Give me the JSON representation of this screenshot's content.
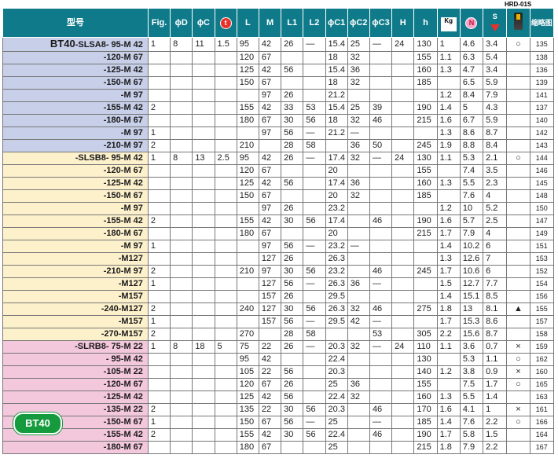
{
  "hrd_caption": "HRD-01S",
  "badge_text": "BT40",
  "headers": [
    "型号",
    "Fig.",
    "ϕD",
    "ϕC",
    "t",
    "L",
    "M",
    "L1",
    "L2",
    "ϕC1",
    "ϕC2",
    "ϕC3",
    "H",
    "h",
    "Kg",
    "N",
    "S",
    "",
    "缩略图"
  ],
  "rows": [
    {
      "g": "g1",
      "pre": "BT40",
      "base": "-SLSA8- 95-M 42",
      "v": [
        "1",
        "8",
        "11",
        "1.5",
        "95",
        "42",
        "26",
        "—",
        "15.4",
        "25",
        "—",
        "24",
        "130",
        "1",
        "4.6",
        "3.4",
        "○",
        "135"
      ]
    },
    {
      "g": "g1",
      "pre": "",
      "base": "-120-M 67",
      "v": [
        "",
        "",
        "",
        "",
        "120",
        "67",
        "",
        "",
        "18",
        "32",
        "",
        "",
        "155",
        "1.1",
        "6.3",
        "5.4",
        "",
        "138"
      ]
    },
    {
      "g": "g1",
      "pre": "",
      "base": "-125-M 42",
      "v": [
        "",
        "",
        "",
        "",
        "125",
        "42",
        "56",
        "",
        "15.4",
        "36",
        "",
        "",
        "160",
        "1.3",
        "4.7",
        "3.4",
        "",
        "136"
      ]
    },
    {
      "g": "g1",
      "pre": "",
      "base": "-150-M 67",
      "v": [
        "",
        "",
        "",
        "",
        "150",
        "67",
        "",
        "",
        "18",
        "32",
        "",
        "",
        "185",
        "",
        "6.5",
        "5.9",
        "",
        "139"
      ]
    },
    {
      "g": "g1",
      "pre": "",
      "base": "-M 97",
      "v": [
        "",
        "",
        "",
        "",
        "",
        "97",
        "26",
        "",
        "21.2",
        "",
        "",
        "",
        "",
        "1.2",
        "8.4",
        "7.9",
        "",
        "141"
      ]
    },
    {
      "g": "g1",
      "pre": "",
      "base": "-155-M 42",
      "v": [
        "2",
        "",
        "",
        "",
        "155",
        "42",
        "33",
        "53",
        "15.4",
        "25",
        "39",
        "",
        "190",
        "1.4",
        "5",
        "4.3",
        "",
        "137"
      ]
    },
    {
      "g": "g1",
      "pre": "",
      "base": "-180-M 67",
      "v": [
        "",
        "",
        "",
        "",
        "180",
        "67",
        "30",
        "56",
        "18",
        "32",
        "46",
        "",
        "215",
        "1.6",
        "6.7",
        "5.9",
        "",
        "140"
      ]
    },
    {
      "g": "g1",
      "pre": "",
      "base": "-M 97",
      "v": [
        "1",
        "",
        "",
        "",
        "",
        "97",
        "56",
        "—",
        "21.2",
        "—",
        "",
        "",
        "",
        "1.3",
        "8.6",
        "8.7",
        "",
        "142"
      ]
    },
    {
      "g": "g1",
      "pre": "",
      "base": "-210-M 97",
      "v": [
        "2",
        "",
        "",
        "",
        "210",
        "",
        "28",
        "58",
        "",
        "36",
        "50",
        "",
        "245",
        "1.9",
        "8.8",
        "8.4",
        "",
        "143"
      ]
    },
    {
      "g": "g2",
      "pre": "",
      "base": "-SLSB8- 95-M 42",
      "v": [
        "1",
        "8",
        "13",
        "2.5",
        "95",
        "42",
        "26",
        "—",
        "17.4",
        "32",
        "—",
        "24",
        "130",
        "1.1",
        "5.3",
        "2.1",
        "○",
        "144"
      ]
    },
    {
      "g": "g2",
      "pre": "",
      "base": "-120-M 67",
      "v": [
        "",
        "",
        "",
        "",
        "120",
        "67",
        "",
        "",
        "20",
        "",
        "",
        "",
        "155",
        "",
        "7.4",
        "3.5",
        "",
        "146"
      ]
    },
    {
      "g": "g2",
      "pre": "",
      "base": "-125-M 42",
      "v": [
        "",
        "",
        "",
        "",
        "125",
        "42",
        "56",
        "",
        "17.4",
        "36",
        "",
        "",
        "160",
        "1.3",
        "5.5",
        "2.3",
        "",
        "145"
      ]
    },
    {
      "g": "g2",
      "pre": "",
      "base": "-150-M 67",
      "v": [
        "",
        "",
        "",
        "",
        "150",
        "67",
        "",
        "",
        "20",
        "32",
        "",
        "",
        "185",
        "",
        "7.6",
        "4",
        "",
        "148"
      ]
    },
    {
      "g": "g2",
      "pre": "",
      "base": "-M 97",
      "v": [
        "",
        "",
        "",
        "",
        "",
        "97",
        "26",
        "",
        "23.2",
        "",
        "",
        "",
        "",
        "1.2",
        "10",
        "5.2",
        "",
        "150"
      ]
    },
    {
      "g": "g2",
      "pre": "",
      "base": "-155-M 42",
      "v": [
        "2",
        "",
        "",
        "",
        "155",
        "42",
        "30",
        "56",
        "17.4",
        "",
        "46",
        "",
        "190",
        "1.6",
        "5.7",
        "2.5",
        "",
        "147"
      ]
    },
    {
      "g": "g2",
      "pre": "",
      "base": "-180-M 67",
      "v": [
        "",
        "",
        "",
        "",
        "180",
        "67",
        "",
        "",
        "20",
        "",
        "",
        "",
        "215",
        "1.7",
        "7.9",
        "4",
        "",
        "149"
      ]
    },
    {
      "g": "g2",
      "pre": "",
      "base": "-M 97",
      "v": [
        "1",
        "",
        "",
        "",
        "",
        "97",
        "56",
        "—",
        "23.2",
        "—",
        "",
        "",
        "",
        "1.4",
        "10.2",
        "6",
        "",
        "151"
      ]
    },
    {
      "g": "g2",
      "pre": "",
      "base": "-M127",
      "v": [
        "",
        "",
        "",
        "",
        "",
        "127",
        "26",
        "",
        "26.3",
        "",
        "",
        "",
        "",
        "1.3",
        "12.6",
        "7",
        "",
        "153"
      ]
    },
    {
      "g": "g2",
      "pre": "",
      "base": "-210-M 97",
      "v": [
        "2",
        "",
        "",
        "",
        "210",
        "97",
        "30",
        "56",
        "23.2",
        "",
        "46",
        "",
        "245",
        "1.7",
        "10.6",
        "6",
        "",
        "152"
      ]
    },
    {
      "g": "g2",
      "pre": "",
      "base": "-M127",
      "v": [
        "1",
        "",
        "",
        "",
        "",
        "127",
        "56",
        "—",
        "26.3",
        "36",
        "—",
        "",
        "",
        "1.5",
        "12.7",
        "7.7",
        "",
        "154"
      ]
    },
    {
      "g": "g2",
      "pre": "",
      "base": "-M157",
      "v": [
        "",
        "",
        "",
        "",
        "",
        "157",
        "26",
        "",
        "29.5",
        "",
        "",
        "",
        "",
        "1.4",
        "15.1",
        "8.5",
        "",
        "156"
      ]
    },
    {
      "g": "g2",
      "pre": "",
      "base": "-240-M127",
      "v": [
        "2",
        "",
        "",
        "",
        "240",
        "127",
        "30",
        "56",
        "26.3",
        "32",
        "46",
        "",
        "275",
        "1.8",
        "13",
        "8.1",
        "▲",
        "155"
      ]
    },
    {
      "g": "g2",
      "pre": "",
      "base": "-M157",
      "v": [
        "1",
        "",
        "",
        "",
        "",
        "157",
        "56",
        "—",
        "29.5",
        "42",
        "—",
        "",
        "",
        "1.7",
        "15.3",
        "8.6",
        "",
        "157"
      ]
    },
    {
      "g": "g2",
      "pre": "",
      "base": "-270-M157",
      "v": [
        "2",
        "",
        "",
        "",
        "270",
        "",
        "28",
        "58",
        "",
        "",
        "53",
        "",
        "305",
        "2.2",
        "15.6",
        "8.7",
        "",
        "158"
      ]
    },
    {
      "g": "g3",
      "pre": "",
      "base": "-SLRB8- 75-M 22",
      "v": [
        "1",
        "8",
        "18",
        "5",
        "75",
        "22",
        "26",
        "—",
        "20.3",
        "32",
        "—",
        "24",
        "110",
        "1.1",
        "3.6",
        "0.7",
        "×",
        "159"
      ]
    },
    {
      "g": "g3",
      "pre": "",
      "base": "- 95-M 42",
      "v": [
        "",
        "",
        "",
        "",
        "95",
        "42",
        "",
        "",
        "22.4",
        "",
        "",
        "",
        "130",
        "",
        "5.3",
        "1.1",
        "○",
        "162"
      ]
    },
    {
      "g": "g3",
      "pre": "",
      "base": "-105-M 22",
      "v": [
        "",
        "",
        "",
        "",
        "105",
        "22",
        "56",
        "",
        "20.3",
        "",
        "",
        "",
        "140",
        "1.2",
        "3.8",
        "0.9",
        "×",
        "160"
      ]
    },
    {
      "g": "g3",
      "pre": "",
      "base": "-120-M 67",
      "v": [
        "",
        "",
        "",
        "",
        "120",
        "67",
        "26",
        "",
        "25",
        "36",
        "",
        "",
        "155",
        "",
        "7.5",
        "1.7",
        "○",
        "165"
      ]
    },
    {
      "g": "g3",
      "pre": "",
      "base": "-125-M 42",
      "v": [
        "",
        "",
        "",
        "",
        "125",
        "42",
        "56",
        "",
        "22.4",
        "32",
        "",
        "",
        "160",
        "1.3",
        "5.5",
        "1.4",
        "",
        "163"
      ]
    },
    {
      "g": "g3",
      "pre": "",
      "base": "-135-M 22",
      "v": [
        "2",
        "",
        "",
        "",
        "135",
        "22",
        "30",
        "56",
        "20.3",
        "",
        "46",
        "",
        "170",
        "1.6",
        "4.1",
        "1",
        "×",
        "161"
      ]
    },
    {
      "g": "g3",
      "pre": "",
      "base": "-150-M 67",
      "v": [
        "1",
        "",
        "",
        "",
        "150",
        "67",
        "56",
        "—",
        "25",
        "",
        "—",
        "",
        "185",
        "1.4",
        "7.6",
        "2.2",
        "○",
        "166"
      ]
    },
    {
      "g": "g3",
      "pre": "",
      "base": "-155-M 42",
      "v": [
        "2",
        "",
        "",
        "",
        "155",
        "42",
        "30",
        "56",
        "22.4",
        "",
        "46",
        "",
        "190",
        "1.7",
        "5.8",
        "1.5",
        "",
        "164"
      ]
    },
    {
      "g": "g3",
      "pre": "",
      "base": "-180-M 67",
      "v": [
        "",
        "",
        "",
        "",
        "180",
        "67",
        "",
        "",
        "25",
        "",
        "",
        "",
        "215",
        "1.8",
        "7.9",
        "2.2",
        "",
        "167"
      ]
    }
  ]
}
